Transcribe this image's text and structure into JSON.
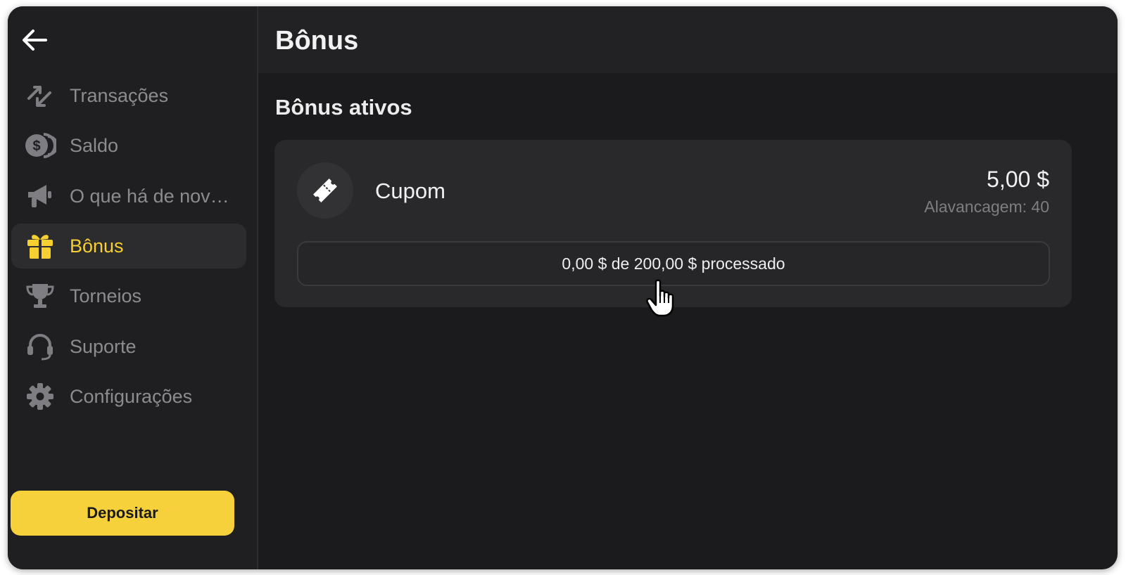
{
  "sidebar": {
    "back_icon": "arrow-left-icon",
    "items": [
      {
        "label": "Transações",
        "icon": "transfer-arrows-icon",
        "active": false
      },
      {
        "label": "Saldo",
        "icon": "coins-icon",
        "active": false
      },
      {
        "label": "O que há de nov…",
        "icon": "megaphone-icon",
        "active": false
      },
      {
        "label": "Bônus",
        "icon": "gift-icon",
        "active": true
      },
      {
        "label": "Torneios",
        "icon": "trophy-icon",
        "active": false
      },
      {
        "label": "Suporte",
        "icon": "headset-icon",
        "active": false
      },
      {
        "label": "Configurações",
        "icon": "gear-icon",
        "active": false
      }
    ],
    "deposit_label": "Depositar"
  },
  "header": {
    "title": "Bônus"
  },
  "main": {
    "section_title": "Bônus ativos",
    "bonus": {
      "name": "Cupom",
      "icon": "ticket-icon",
      "amount": "5,00 $",
      "leverage": "Alavancagem: 40",
      "progress_text": "0,00 $ de 200,00 $ processado",
      "progress_fraction": 0
    }
  },
  "colors": {
    "accent": "#f6cf31",
    "background": "#1b1b1d",
    "sidebar": "#1f1f21",
    "card": "#29292b"
  }
}
